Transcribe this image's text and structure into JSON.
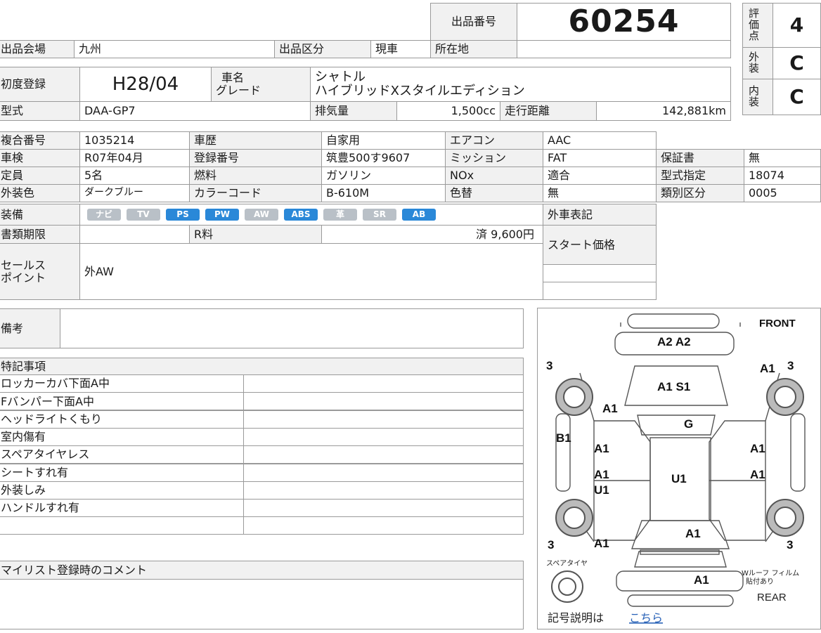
{
  "header": {
    "lot_label": "出品番号",
    "lot_number": "60254",
    "venue_label": "出品会場",
    "venue_value": "九州",
    "category_label": "出品区分",
    "category_value": "現車",
    "location_label": "所在地",
    "location_value": ""
  },
  "grades": {
    "score_label": "評価点",
    "score_value": "4",
    "exterior_label": "外装",
    "exterior_value": "C",
    "interior_label": "内装",
    "interior_value": "C"
  },
  "vehicle": {
    "first_reg_label": "初度登録",
    "first_reg_value": "H28/04",
    "name_label_1": "車名",
    "name_label_2": "グレード",
    "name_value_1": "シャトル",
    "name_value_2": "ハイブリッドXスタイルエディション",
    "model_label": "型式",
    "model_value": "DAA-GP7",
    "displacement_label": "排気量",
    "displacement_value": "1,500cc",
    "mileage_label": "走行距離",
    "mileage_value": "142,881km"
  },
  "specs": {
    "rows": [
      {
        "l1": "複合番号",
        "v1": "1035214",
        "l2": "車歴",
        "v2": "自家用",
        "l3": "エアコン",
        "v3": "AAC"
      },
      {
        "l1": "車検",
        "v1": "R07年04月",
        "l2": "登録番号",
        "v2": "筑豊500す9607",
        "l3": "ミッション",
        "v3": "FAT"
      },
      {
        "l1": "定員",
        "v1": "5名",
        "l2": "燃料",
        "v2": "ガソリン",
        "l3": "NOx",
        "v3": "適合"
      },
      {
        "l1": "外装色",
        "v1": "ダークブルー",
        "l2": "カラーコード",
        "v2": "B-610M",
        "l3": "色替",
        "v3": "無"
      }
    ],
    "side": [
      {
        "label": "保証書",
        "value": "無"
      },
      {
        "label": "型式指定",
        "value": "18074"
      },
      {
        "label": "類別区分",
        "value": "0005"
      }
    ]
  },
  "equipment": {
    "label": "装備",
    "badges": [
      {
        "text": "ナビ",
        "on": false
      },
      {
        "text": "TV",
        "on": false
      },
      {
        "text": "PS",
        "on": true
      },
      {
        "text": "PW",
        "on": true
      },
      {
        "text": "AW",
        "on": false
      },
      {
        "text": "ABS",
        "on": true
      },
      {
        "text": "革",
        "on": false
      },
      {
        "text": "SR",
        "on": false
      },
      {
        "text": "AB",
        "on": true
      }
    ],
    "foreign_label": "外車表記"
  },
  "docs": {
    "label": "書類期限",
    "r_label": "R料",
    "r_value": "済 9,600円",
    "start_price_label": "スタート価格"
  },
  "sales": {
    "label_1": "セールス",
    "label_2": "ポイント",
    "value": "外AW"
  },
  "remarks": {
    "label": "備考",
    "value": ""
  },
  "notes": {
    "label": "特記事項",
    "items": [
      "ロッカーカバ下面A中",
      "Fバンパー下面A中",
      "ヘッドライトくもり",
      "室内傷有",
      "スペアタイヤレス",
      "シートすれ有",
      "外装しみ",
      "ハンドルすれ有",
      ""
    ]
  },
  "comment": {
    "label": "マイリスト登録時のコメント"
  },
  "diagram": {
    "front_label": "FRONT",
    "rear_label": "REAR",
    "marks": [
      "A2 A2",
      "A1",
      "3",
      "A1 S1",
      "A1",
      "G",
      "B1",
      "A1",
      "A1",
      "A1",
      "U1",
      "U1",
      "A1",
      "A1",
      "A1",
      "A1",
      "3",
      "3",
      "3",
      "A1"
    ],
    "spare_label": "スペアタイヤ",
    "sticker_note_1": "Wルーフ フィルム",
    "sticker_note_2": "貼付あり",
    "legend_text": "記号説明は",
    "legend_link": "こちら"
  }
}
